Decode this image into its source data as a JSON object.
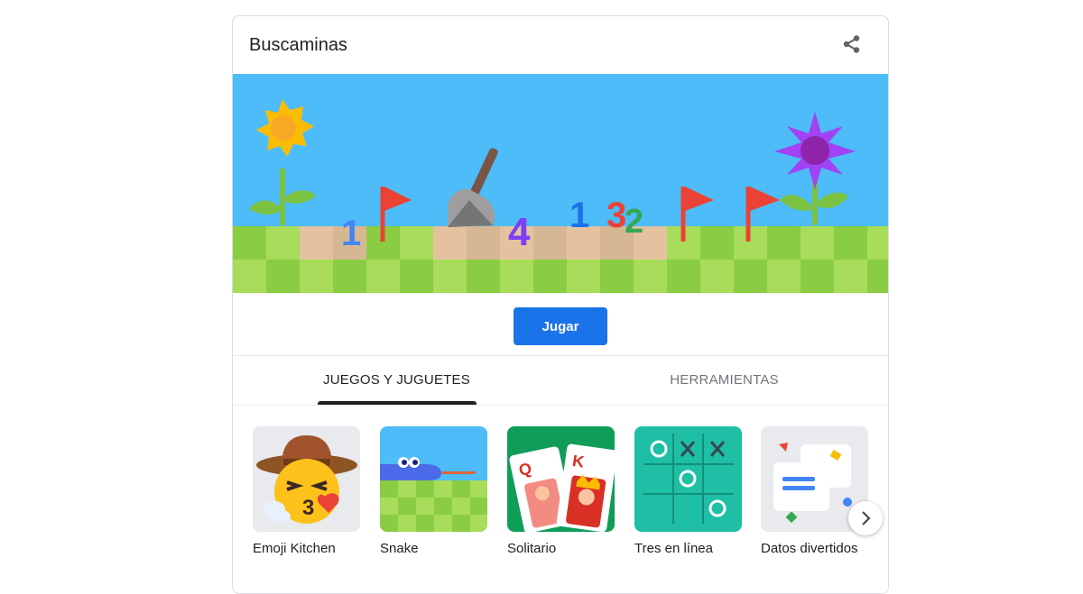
{
  "card": {
    "title": "Buscaminas",
    "share_icon": "share-icon"
  },
  "hero": {
    "numbers": [
      "1",
      "4",
      "1",
      "3",
      "2"
    ],
    "colors": {
      "sky": "#4dbcf8",
      "grass_light": "#a8dc5a",
      "grass_dark": "#8acd42",
      "dug": "#e4c29f",
      "flag": "#ea4335"
    }
  },
  "play_button": {
    "label": "Jugar",
    "color": "#1a73e8"
  },
  "tabs": [
    {
      "label": "JUEGOS Y JUGUETES",
      "active": true
    },
    {
      "label": "HERRAMIENTAS",
      "active": false
    }
  ],
  "games": [
    {
      "label": "Emoji Kitchen",
      "icon": "emoji-kitchen-icon"
    },
    {
      "label": "Snake",
      "icon": "snake-icon"
    },
    {
      "label": "Solitario",
      "icon": "solitaire-icon",
      "card_letters": [
        "Q",
        "K"
      ]
    },
    {
      "label": "Tres en línea",
      "icon": "tic-tac-toe-icon"
    },
    {
      "label": "Datos divertidos",
      "icon": "fun-facts-icon"
    }
  ],
  "next_button_icon": "chevron-right-icon"
}
